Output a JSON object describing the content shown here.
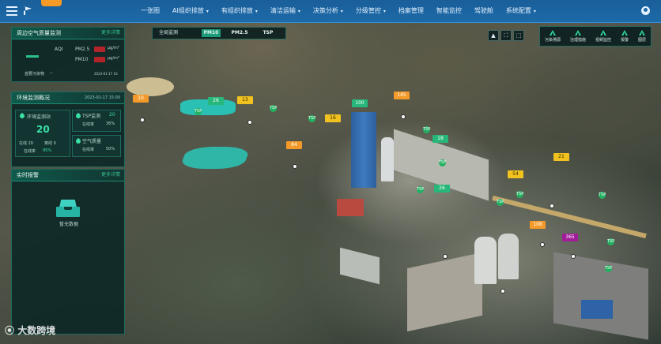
{
  "topbar": {
    "nav": [
      {
        "label": "一张图",
        "has_menu": false
      },
      {
        "label": "AI组织排放",
        "has_menu": true
      },
      {
        "label": "有组织排放",
        "has_menu": true
      },
      {
        "label": "清洁运输",
        "has_menu": true
      },
      {
        "label": "决策分析",
        "has_menu": true
      },
      {
        "label": "分级管控",
        "has_menu": true
      },
      {
        "label": "档案管理",
        "has_menu": false
      },
      {
        "label": "智能监控",
        "has_menu": false
      },
      {
        "label": "驾驶舱",
        "has_menu": false
      },
      {
        "label": "系统配置",
        "has_menu": true
      }
    ]
  },
  "panel1": {
    "title": "周边空气质量监测",
    "more": "更多详情",
    "aqi_label": "AQI",
    "pm25_label": "PM2.5",
    "pm10_label": "PM10",
    "unit": "μg/m³",
    "primary_label": "首要污染物",
    "primary_value": "--",
    "timestamp": "2023-01-17 16"
  },
  "panel2": {
    "title": "环境监测概况",
    "timestamp": "2023-01-17 15:00",
    "card1_title": "环境监测站",
    "card1_value": "20",
    "card1_sub1": "在线 20",
    "card1_sub2": "离线 0",
    "card1_rate_label": "在线率",
    "card1_rate_value": "95%",
    "card2_title": "TSP监测",
    "card2_value": "20",
    "card2_rate_label": "在线率",
    "card2_rate_value": "36%",
    "card3_title": "空气质量",
    "card3_rate_label": "在线率",
    "card3_rate_value": "50%"
  },
  "panel3": {
    "title": "实时报警",
    "more": "更多详情",
    "empty_text": "暂无数据"
  },
  "pollutant_tabs": {
    "title": "全局监测",
    "tabs": [
      "PM10",
      "PM2.5",
      "TSP"
    ],
    "active": "PM10"
  },
  "tools": [
    {
      "label": "污染溯源",
      "icon": "source-icon"
    },
    {
      "label": "治理措施",
      "icon": "measure-icon"
    },
    {
      "label": "视频监控",
      "icon": "video-icon"
    },
    {
      "label": "报警",
      "icon": "alarm-icon"
    },
    {
      "label": "图层",
      "icon": "layer-icon"
    }
  ],
  "view_buttons": [
    "▲",
    "⛶",
    "⬚"
  ],
  "markers": [
    {
      "value": "10",
      "color": "o"
    },
    {
      "value": "26",
      "color": "g"
    },
    {
      "value": "13",
      "color": "y"
    },
    {
      "value": "145",
      "color": "o"
    },
    {
      "value": "16",
      "color": "y"
    },
    {
      "value": "84",
      "color": "o"
    },
    {
      "value": "18",
      "color": "g"
    },
    {
      "value": "54",
      "color": "y"
    },
    {
      "value": "21",
      "color": "y"
    },
    {
      "value": "26",
      "color": "g"
    },
    {
      "value": "108",
      "color": "o"
    },
    {
      "value": "365",
      "color": "p"
    },
    {
      "value": "100",
      "color": "g"
    }
  ],
  "tsp_label": "TSP",
  "watermark": "大数跨境",
  "watermark_icon": "DC-logo-icon"
}
